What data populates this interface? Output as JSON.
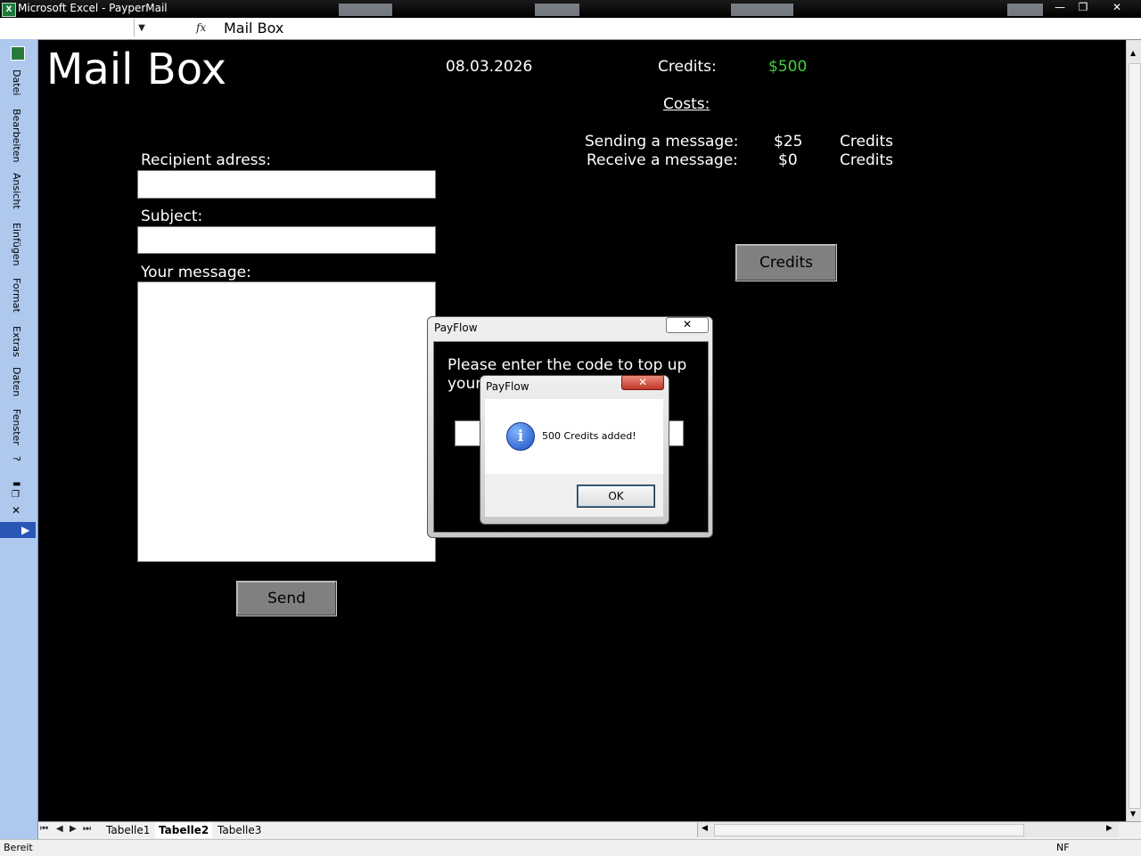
{
  "window": {
    "title": "Microsoft Excel - PayperMail",
    "app_icon_glyph": "X",
    "minimize_glyph": "—",
    "restore_glyph": "❐",
    "close_glyph": "✕"
  },
  "formula_bar": {
    "name_box_value": "",
    "formula_value": "Mail Box"
  },
  "left_menu": {
    "items": [
      "Datei",
      "Bearbeiten",
      "Ansicht",
      "Einfügen",
      "Format",
      "Extras",
      "Daten",
      "Fenster",
      "?"
    ]
  },
  "sheet": {
    "title": "Mail Box",
    "date": "08.03.2026",
    "credits_label": "Credits:",
    "credits_value": "$500",
    "credits_value_color": "#3fd13f",
    "costs_label": "Costs:",
    "costs": [
      {
        "label": "Sending a message:",
        "amount": "$25",
        "unit": "Credits"
      },
      {
        "label": "Receive a message:",
        "amount": "$0",
        "unit": "Credits"
      }
    ],
    "recipient_label": "Recipient adress:",
    "recipient_value": "",
    "subject_label": "Subject:",
    "subject_value": "",
    "message_label": "Your message:",
    "message_value": "",
    "send_button": "Send",
    "credits_button": "Credits"
  },
  "payflow_dialog": {
    "caption": "PayFlow",
    "prompt": "Please enter the code to top up your",
    "code_value": ""
  },
  "message_box": {
    "caption": "PayFlow",
    "icon": "info-icon",
    "message": "500 Credits added!",
    "ok_button": "OK"
  },
  "tabs": {
    "sheets": [
      "Tabelle1",
      "Tabelle2",
      "Tabelle3"
    ],
    "active": "Tabelle2"
  },
  "status": {
    "ready": "Bereit",
    "indicator": "NF"
  }
}
